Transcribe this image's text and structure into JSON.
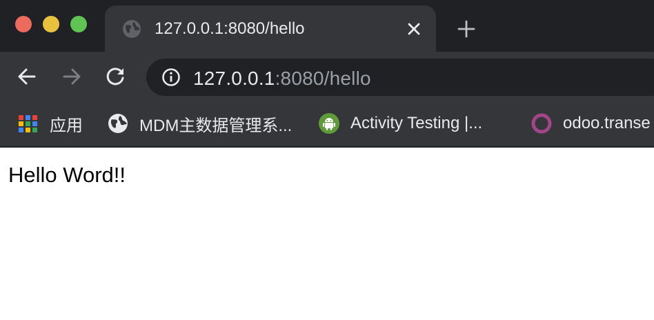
{
  "window": {
    "controls": [
      "close",
      "minimize",
      "zoom"
    ],
    "colors": {
      "close": "#ed6a5e",
      "minimize": "#e8c23f",
      "zoom": "#5fc454"
    }
  },
  "tab": {
    "title": "127.0.0.1:8080/hello",
    "icon": "globe-icon",
    "close_icon": "close-icon"
  },
  "new_tab_icon": "plus-icon",
  "toolbar": {
    "back_icon": "arrow-left-icon",
    "forward_icon": "arrow-right-icon",
    "reload_icon": "reload-icon"
  },
  "address_bar": {
    "info_icon": "info-icon",
    "host": "127.0.0.1",
    "rest": ":8080/hello"
  },
  "bookmarks": [
    {
      "label": "应用",
      "icon": "apps-grid-icon"
    },
    {
      "label": "MDM主数据管理系...",
      "icon": "globe-icon"
    },
    {
      "label": "Activity Testing |...",
      "icon": "android-icon"
    },
    {
      "label": "odoo.transe",
      "icon": "odoo-icon"
    }
  ],
  "page": {
    "text": "Hello Word!!"
  }
}
